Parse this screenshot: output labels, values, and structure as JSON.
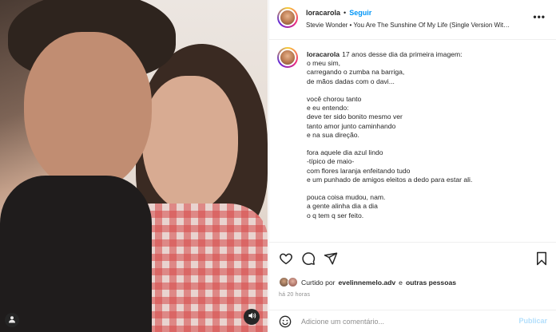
{
  "post": {
    "username": "loracarola",
    "follow_label": "Seguir",
    "separator": "•",
    "audio": "Stevie Wonder • You Are The Sunshine Of My Life (Single Version Wit…",
    "more_label": "•••"
  },
  "caption": {
    "username": "loracarola",
    "lines": [
      "17 anos desse dia da primeira imagem:",
      "o meu sim,",
      "carregando o zumba na barriga,",
      "de mãos dadas com o davi...",
      "",
      "você chorou tanto",
      "e eu entendo:",
      "deve ter sido bonito mesmo ver",
      "tanto amor junto caminhando",
      "e na sua direção.",
      "",
      "fora aquele dia azul lindo",
      "-típico de maio-",
      "com flores laranja enfeitando tudo",
      "e um punhado de amigos eleitos a dedo para estar ali.",
      "",
      "pouca coisa mudou, nam.",
      "a gente alinha dia a dia",
      "o q tem q ser feito."
    ]
  },
  "likes": {
    "prefix": "Curtido por",
    "user": "evelinnemelo.adv",
    "connector": "e",
    "others": "outras pessoas"
  },
  "time": "há 20 horas",
  "comment": {
    "placeholder": "Adicione um comentário...",
    "publish_label": "Publicar"
  },
  "icons": {
    "like": "heart-icon",
    "comment": "comment-icon",
    "share": "send-icon",
    "save": "bookmark-icon",
    "emoji": "smiley-icon",
    "sound": "speaker-icon",
    "tagged": "person-icon"
  },
  "colors": {
    "link": "#0095f6",
    "muted": "#8e8e8e",
    "publish_disabled": "#b2dffc"
  }
}
